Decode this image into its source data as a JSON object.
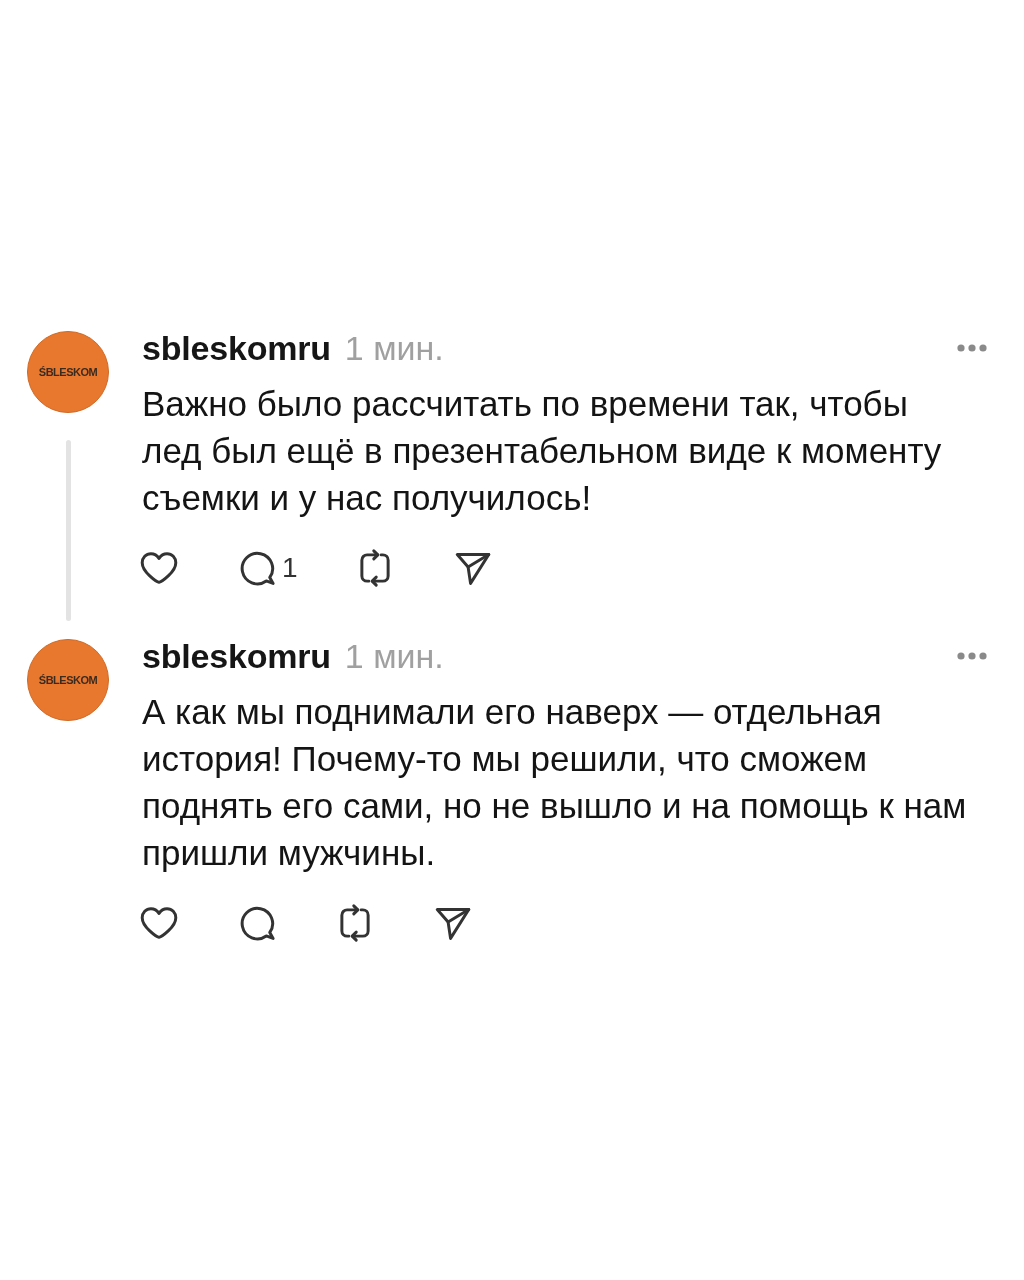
{
  "posts": [
    {
      "avatar": {
        "logo_text": "ŚBLESKOM"
      },
      "username": "sbleskomru",
      "time": "1 мин.",
      "text": "Важно было рассчитать по времени так, чтобы лед был ещё в презентабельном виде к моменту съемки и у нас получилось!",
      "thread_continues": true,
      "actions": [
        {
          "kind": "like"
        },
        {
          "kind": "comment",
          "count": "1"
        },
        {
          "kind": "repost"
        },
        {
          "kind": "share"
        }
      ]
    },
    {
      "avatar": {
        "logo_text": "ŚBLESKOM"
      },
      "username": "sbleskomru",
      "time": "1 мин.",
      "text": "А как мы поднимали его наверх — отдельная история! Почему-то мы решили, что сможем поднять его сами, но не вышло и на помощь к нам пришли мужчины.",
      "thread_continues": false,
      "actions": [
        {
          "kind": "like"
        },
        {
          "kind": "comment"
        },
        {
          "kind": "repost"
        },
        {
          "kind": "share"
        }
      ]
    }
  ]
}
